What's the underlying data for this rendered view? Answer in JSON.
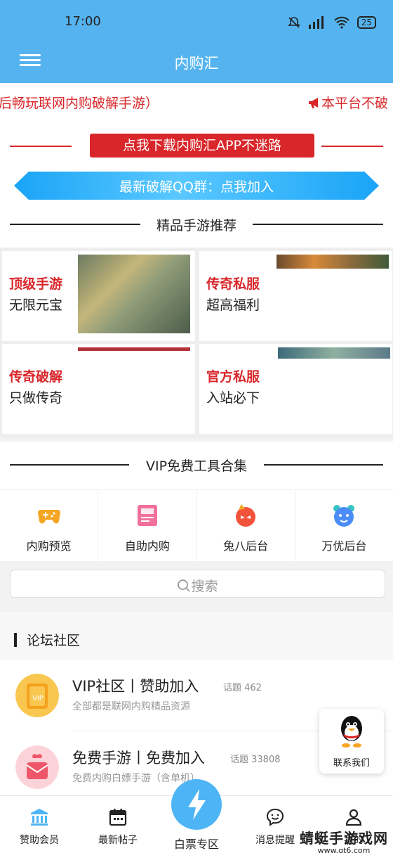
{
  "status_bar": {
    "time": "17:00",
    "battery": "25"
  },
  "app_bar": {
    "title": "内购汇"
  },
  "marquee": {
    "text_left": "后畅玩联网内购破解手游）",
    "text_right": "本平台不破"
  },
  "download_banner": {
    "label": "点我下载内购汇APP不迷路"
  },
  "qq_banner": {
    "label": "最新破解QQ群：点我加入"
  },
  "games_section": {
    "title": "精品手游推荐",
    "cards": [
      {
        "title": "顶级手游",
        "subtitle": "无限元宝"
      },
      {
        "title": "传奇私服",
        "subtitle": "超高福利"
      },
      {
        "title": "传奇破解",
        "subtitle": "只做传奇"
      },
      {
        "title": "官方私服",
        "subtitle": "入站必下"
      }
    ]
  },
  "tools_section": {
    "title": "VIP免费工具合集",
    "items": [
      {
        "label": "内购预览",
        "icon": "gamepad-icon",
        "color": "#f5a623"
      },
      {
        "label": "自助内购",
        "icon": "card-icon",
        "color": "#f0719a"
      },
      {
        "label": "兔八后台",
        "icon": "rabbit-face-icon",
        "color": "#f2533a"
      },
      {
        "label": "万优后台",
        "icon": "bear-face-icon",
        "color": "#4a8df8"
      }
    ]
  },
  "search": {
    "placeholder": "搜索"
  },
  "forum": {
    "title": "论坛社区",
    "boards": [
      {
        "name": "VIP社区丨赞助加入",
        "topics": "话题 462",
        "desc": "全部都是联网内购精品资源"
      },
      {
        "name": "免费手游丨免费加入",
        "topics": "话题 33808",
        "desc": "免费内购白嫖手游（含单机）"
      }
    ]
  },
  "floating_contact": {
    "label": "联系我们"
  },
  "tab_bar": {
    "tabs": [
      {
        "label": "赞助会员",
        "icon": "bank-icon"
      },
      {
        "label": "最新帖子",
        "icon": "calendar-icon"
      },
      {
        "label": "白票专区",
        "icon": "lightning-icon"
      },
      {
        "label": "消息提醒",
        "icon": "chat-icon"
      },
      {
        "label": "我的",
        "icon": "user-icon"
      }
    ]
  },
  "watermark": {
    "line1": "蜻蜓手游戏网",
    "line2": "www.qt6.com"
  },
  "colors": {
    "primary": "#55b4f0",
    "accent_red": "#d9262a"
  }
}
